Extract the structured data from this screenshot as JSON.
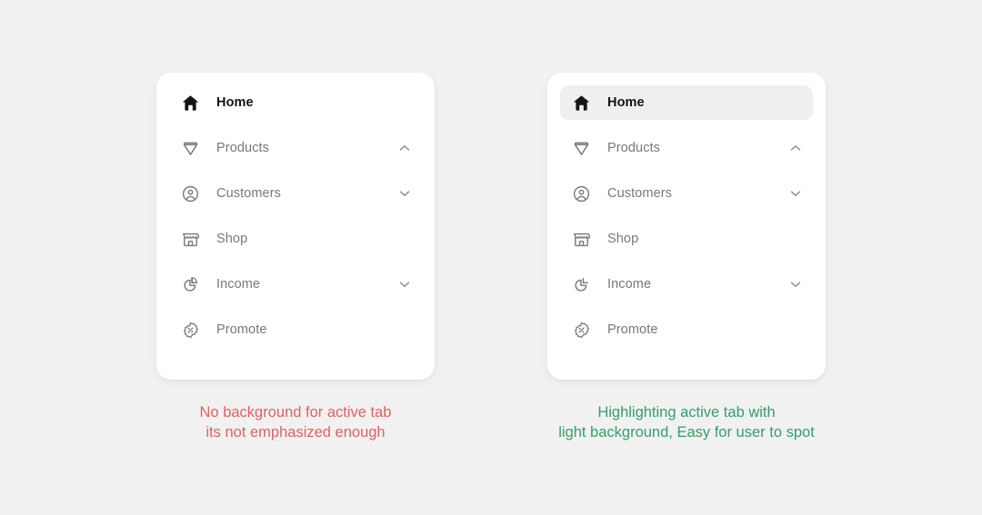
{
  "theme": {
    "page_background": "#f1f1f1",
    "card_background": "#ffffff",
    "active_highlight": "#efefef",
    "label_color": "#78787c",
    "active_label_color": "#131313",
    "bad_caption_color": "#e2605f",
    "good_caption_color": "#34a06a"
  },
  "panels": [
    {
      "id": "panel-without-highlight",
      "active_has_background": false,
      "items": [
        {
          "label": "Home",
          "icon": "home-icon",
          "active": true,
          "chevron": "none"
        },
        {
          "label": "Products",
          "icon": "diamond-icon",
          "active": false,
          "chevron": "up"
        },
        {
          "label": "Customers",
          "icon": "user-circle-icon",
          "active": false,
          "chevron": "down"
        },
        {
          "label": "Shop",
          "icon": "storefront-icon",
          "active": false,
          "chevron": "none"
        },
        {
          "label": "Income",
          "icon": "pie-chart-icon",
          "active": false,
          "chevron": "down"
        },
        {
          "label": "Promote",
          "icon": "discount-badge-icon",
          "active": false,
          "chevron": "none"
        }
      ],
      "caption": "No background for active tab\nits not emphasized enough"
    },
    {
      "id": "panel-with-highlight",
      "active_has_background": true,
      "items": [
        {
          "label": "Home",
          "icon": "home-icon",
          "active": true,
          "chevron": "none"
        },
        {
          "label": "Products",
          "icon": "diamond-icon",
          "active": false,
          "chevron": "up"
        },
        {
          "label": "Customers",
          "icon": "user-circle-icon",
          "active": false,
          "chevron": "down"
        },
        {
          "label": "Shop",
          "icon": "storefront-icon",
          "active": false,
          "chevron": "none"
        },
        {
          "label": "Income",
          "icon": "pie-chart-icon",
          "active": false,
          "chevron": "down"
        },
        {
          "label": "Promote",
          "icon": "discount-badge-icon",
          "active": false,
          "chevron": "none"
        }
      ],
      "caption": "Highlighting active tab with\nlight background, Easy for user to spot"
    }
  ]
}
